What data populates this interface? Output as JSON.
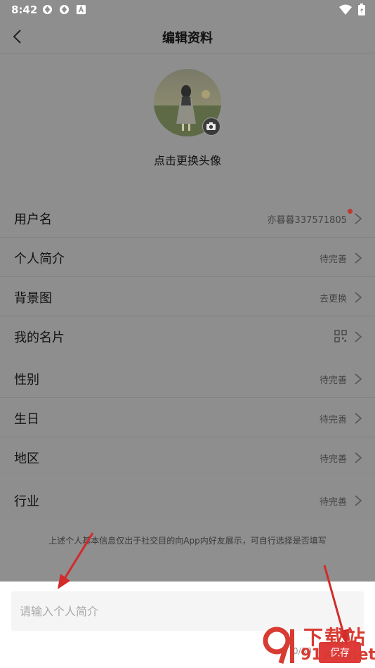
{
  "status": {
    "time": "8:42"
  },
  "header": {
    "title": "编辑资料"
  },
  "avatar": {
    "hint": "点击更换头像"
  },
  "rows_group1": [
    {
      "label": "用户名",
      "value": "亦暮暮337571805"
    },
    {
      "label": "个人简介",
      "value": "待完善"
    },
    {
      "label": "背景图",
      "value": "去更换"
    },
    {
      "label": "我的名片",
      "value": ""
    }
  ],
  "rows_group2": [
    {
      "label": "性别",
      "value": "待完善"
    },
    {
      "label": "生日",
      "value": "待完善"
    },
    {
      "label": "地区",
      "value": "待完善"
    }
  ],
  "rows_group3": [
    {
      "label": "行业",
      "value": "待完善"
    }
  ],
  "footnote": "上述个人基本信息仅出于社交目的向App内好友展示，可自行选择是否填写",
  "bio_input": {
    "placeholder": "请输入个人简介",
    "value": "",
    "counter": "0/30",
    "save_label": "保存"
  },
  "watermark": {
    "line1": "下载站",
    "line2": "91xz.net"
  },
  "colors": {
    "accent": "#e03a3a",
    "overlay": "#8e8e8e"
  }
}
